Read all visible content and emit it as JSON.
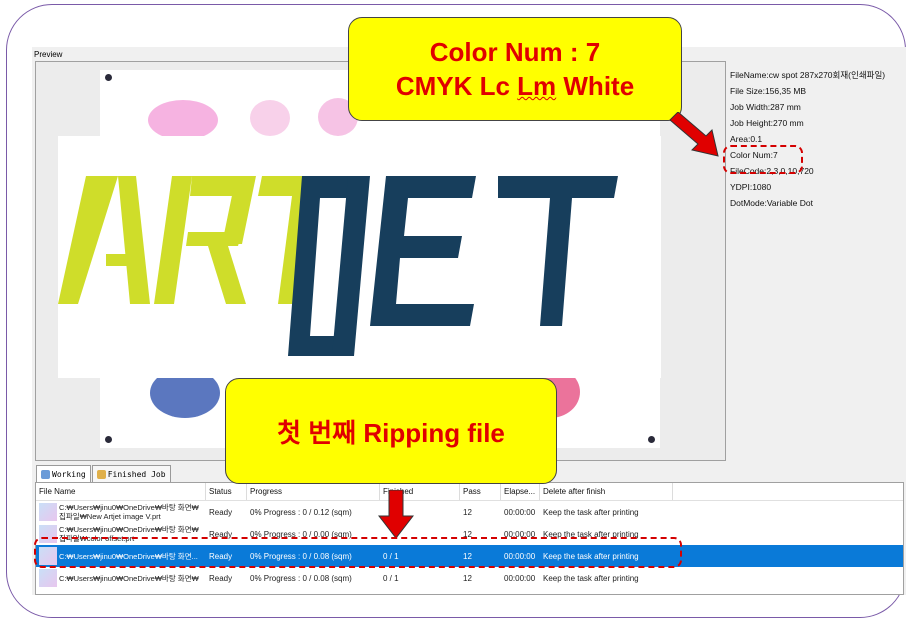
{
  "preview": {
    "title": "Preview"
  },
  "logo_text": "ARTJET",
  "file_info": {
    "lines": [
      "FileName:cw spot 287x270회재(인쇄파일)",
      "File Size:156,35 MB",
      "Job Width:287 mm",
      "Job Height:270 mm",
      "Area:0.1",
      "Color Num:7",
      "FileCode:2,3,0,10,720",
      "YDPI:1080",
      "DotMode:Variable Dot"
    ]
  },
  "tabs": [
    {
      "label": "Working",
      "icon": "working-icon"
    },
    {
      "label": "Finished Job",
      "icon": "finished-job-icon"
    }
  ],
  "table": {
    "headers": [
      "File Name",
      "Status",
      "Progress",
      "Finished",
      "Pass",
      "Elapse...",
      "Delete after finish"
    ],
    "rows": [
      {
        "file_line1": "C:₩Users₩jinu0₩OneDrive₩바탕 화면₩",
        "file_line2": "집파일₩New Artjet image V.prt",
        "status": "Ready",
        "progress": "0%  Progress : 0 / 0.12 (sqm)",
        "finished": "",
        "pass": "12",
        "elapsed": "00:00:00",
        "delete": "Keep the task after printing"
      },
      {
        "file_line1": "C:₩Users₩jinu0₩OneDrive₩바탕 화면₩",
        "file_line2": "집파일₩color offset.prt",
        "status": "Ready",
        "progress": "0%  Progress : 0 / 0.00 (sqm)",
        "finished": "",
        "pass": "12",
        "elapsed": "00:00:00",
        "delete": "Keep the task after printing"
      },
      {
        "file_line1": "C:₩Users₩jinu0₩OneDrive₩바탕 화면...",
        "file_line2": "",
        "status": "Ready",
        "progress": "0%  Progress : 0 / 0.08 (sqm)",
        "finished": "0 / 1",
        "pass": "12",
        "elapsed": "00:00:00",
        "delete": "Keep the task after printing",
        "selected": true
      },
      {
        "file_line1": "C:₩Users₩jinu0₩OneDrive₩바탕 화면₩",
        "file_line2": "",
        "status": "Ready",
        "progress": "0%  Progress : 0 / 0.08 (sqm)",
        "finished": "0 / 1",
        "pass": "12",
        "elapsed": "00:00:00",
        "delete": "Keep the task after printing"
      }
    ]
  },
  "callouts": {
    "color_num_line1": "Color Num : 7",
    "color_num_line2_a": "CMYK Lc ",
    "color_num_line2_b": "Lm",
    "color_num_line2_c": " White",
    "ripping": "첫 번째 Ripping file"
  },
  "colors": {
    "callout_bg": "#ffff00",
    "callout_text": "#e00000",
    "logo_green": "#cfdd2a",
    "logo_navy": "#173e5c",
    "selected_row": "#0a7ad8",
    "frame": "#7a5aa8"
  }
}
